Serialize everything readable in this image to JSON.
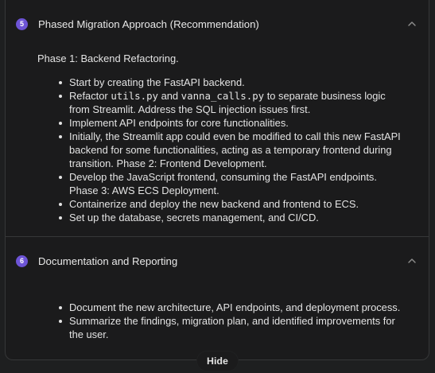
{
  "sections": [
    {
      "number": "5",
      "title": "Phased Migration Approach (Recommendation)",
      "chevron_icon": "chevron-up-icon",
      "phase_title": "Phase 1: Backend Refactoring.",
      "bullets": [
        {
          "text": "Start by creating the FastAPI backend."
        },
        {
          "pre": "Refactor ",
          "code1": "utils.py",
          "mid": " and ",
          "code2": "vanna_calls.py",
          "post": " to separate business logic from Streamlit. Address the SQL injection issues first."
        },
        {
          "text": "Implement API endpoints for core functionalities."
        },
        {
          "text": "Initially, the Streamlit app could even be modified to call this new FastAPI backend for some functionalities, acting as a temporary frontend during transition. Phase 2: Frontend Development."
        },
        {
          "text": "Develop the JavaScript frontend, consuming the FastAPI endpoints. Phase 3: AWS ECS Deployment."
        },
        {
          "text": "Containerize and deploy the new backend and frontend to ECS."
        },
        {
          "text": "Set up the database, secrets management, and CI/CD."
        }
      ]
    },
    {
      "number": "6",
      "title": "Documentation and Reporting",
      "chevron_icon": "chevron-up-icon",
      "bullets": [
        {
          "text": "Document the new architecture, API endpoints, and deployment process."
        },
        {
          "text": "Summarize the findings, migration plan, and identified improvements for the user."
        }
      ]
    }
  ],
  "hide_button": {
    "label": "Hide"
  },
  "colors": {
    "background": "#1e1f20",
    "panel": "#1b1b1c",
    "badge": "#6d54d6",
    "text": "#e3e3e3",
    "border": "#363738"
  }
}
